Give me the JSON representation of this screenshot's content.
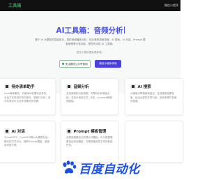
{
  "header": {
    "logo_text": "工具箱",
    "right_link": "微信小程序"
  },
  "hero": {
    "title": "AI工具箱：音频分析",
    "description": "基于 AI 大模型的智能助手，提供音频播放分析、待办清单语音录音、AI 搜索、AI 对话、Prompt 模板管理等丰富功能，是您的手机 AI 工具箱。",
    "note": "您在小程序里免费体验：",
    "btn_wechat": "关注微信公众号使用",
    "btn_weapp": "微信小程序体验"
  },
  "features": [
    {
      "title": "待办清单助手",
      "text": "todo清单服务，可使用AI处理待办任务，对话方式来进行待办事件，语音行分析，待办列表也可以在多设备同步查看。"
    },
    {
      "title": "音频分析",
      "text": "生成音频的分析数据，可帮你分析原始片段，支持本地的文件、B站、youtube等视频链接。"
    },
    {
      "title": "AI 搜索",
      "text": "AI搜索引擎搜索和结合，生成搜索结果答案，给出全部的文章引用，多参考提升答案的速度。"
    },
    {
      "title": "AI 对话",
      "text": "与ChatGPT、ChatGLM等AI大模型对话，聊天的方式可以，拥有Prompt模板，使用起来更方便。"
    },
    {
      "title": "Prompt 模板管理",
      "text": "定制保管理自己的提示词模板，可以根据需要自由添加模板，方便快速完成文本的各类任务。"
    },
    {
      "title": "",
      "text": ""
    }
  ],
  "watermark": {
    "text": "百度自动化",
    "color": "#1a50e6"
  },
  "colors": {
    "accent": "#4a51e8",
    "button_primary": "#4a3fe0",
    "brand_green": "#2aa45a",
    "topbar": "#111111"
  }
}
